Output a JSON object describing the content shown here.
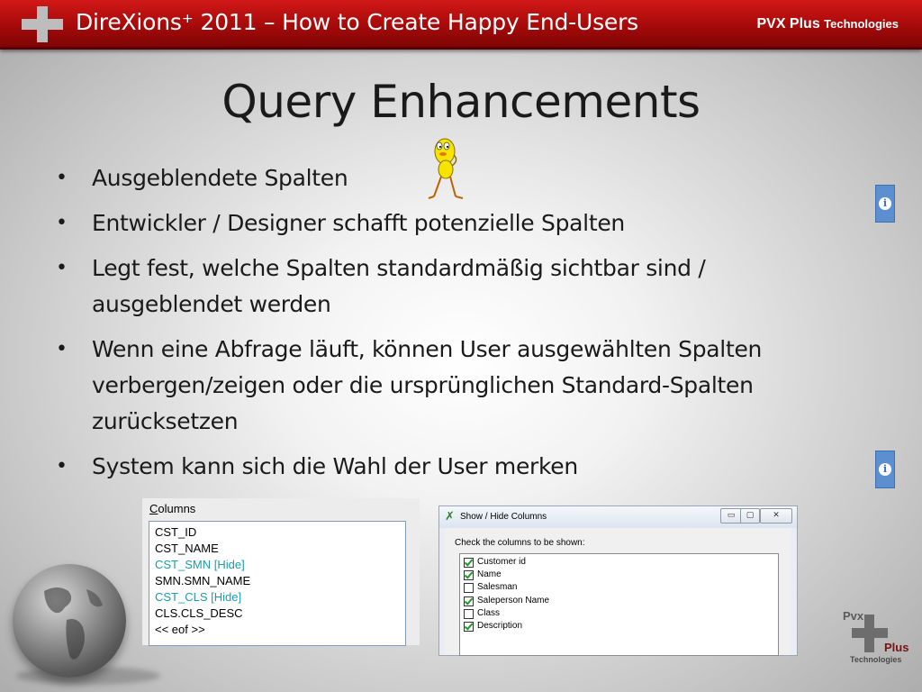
{
  "header": {
    "title": "DireXions⁺ 2011 – How to Create Happy End-Users",
    "brand_main": "PVX Plus",
    "brand_sub": "Technologies"
  },
  "slide": {
    "title": "Query Enhancements",
    "bullets": [
      "Ausgeblendete Spalten",
      "Entwickler / Designer schafft potenzielle Spalten",
      "Legt fest, welche Spalten standardmäßig sichtbar sind / ausgeblendet werden",
      "Wenn eine Abfrage läuft, können User ausgewählten Spalten verbergen/zeigen oder die ursprünglichen Standard-Spalten zurücksetzen",
      "System kann sich die Wahl der User merken"
    ]
  },
  "columns_panel": {
    "label_first": "C",
    "label_rest": "olumns",
    "items": [
      {
        "text": "CST_ID",
        "hidden": false
      },
      {
        "text": "CST_NAME",
        "hidden": false
      },
      {
        "text": "CST_SMN  [Hide]",
        "hidden": true
      },
      {
        "text": "SMN.SMN_NAME",
        "hidden": false
      },
      {
        "text": "CST_CLS  [Hide]",
        "hidden": true
      },
      {
        "text": "CLS.CLS_DESC",
        "hidden": false
      },
      {
        "text": "<< eof >>",
        "hidden": false
      }
    ]
  },
  "dialog": {
    "title": "Show / Hide Columns",
    "prompt": "Check the columns to be shown:",
    "window_buttons": [
      "▭",
      "▢",
      "✕"
    ],
    "options": [
      {
        "label": "Customer id",
        "checked": true
      },
      {
        "label": "Name",
        "checked": true
      },
      {
        "label": "Salesman",
        "checked": false
      },
      {
        "label": "Saleperson Name",
        "checked": true
      },
      {
        "label": "Class",
        "checked": false
      },
      {
        "label": "Description",
        "checked": true
      }
    ]
  },
  "footer_logo": {
    "pvx": "Pvx",
    "plus": "Plus",
    "technologies": "Technologies"
  },
  "info_icon_glyph": "i",
  "colors": {
    "header_red": "#b01010",
    "hidden_column_text": "#1a9bb0",
    "info_button": "#5b8fd0",
    "checkmark": "#1c9b26"
  }
}
